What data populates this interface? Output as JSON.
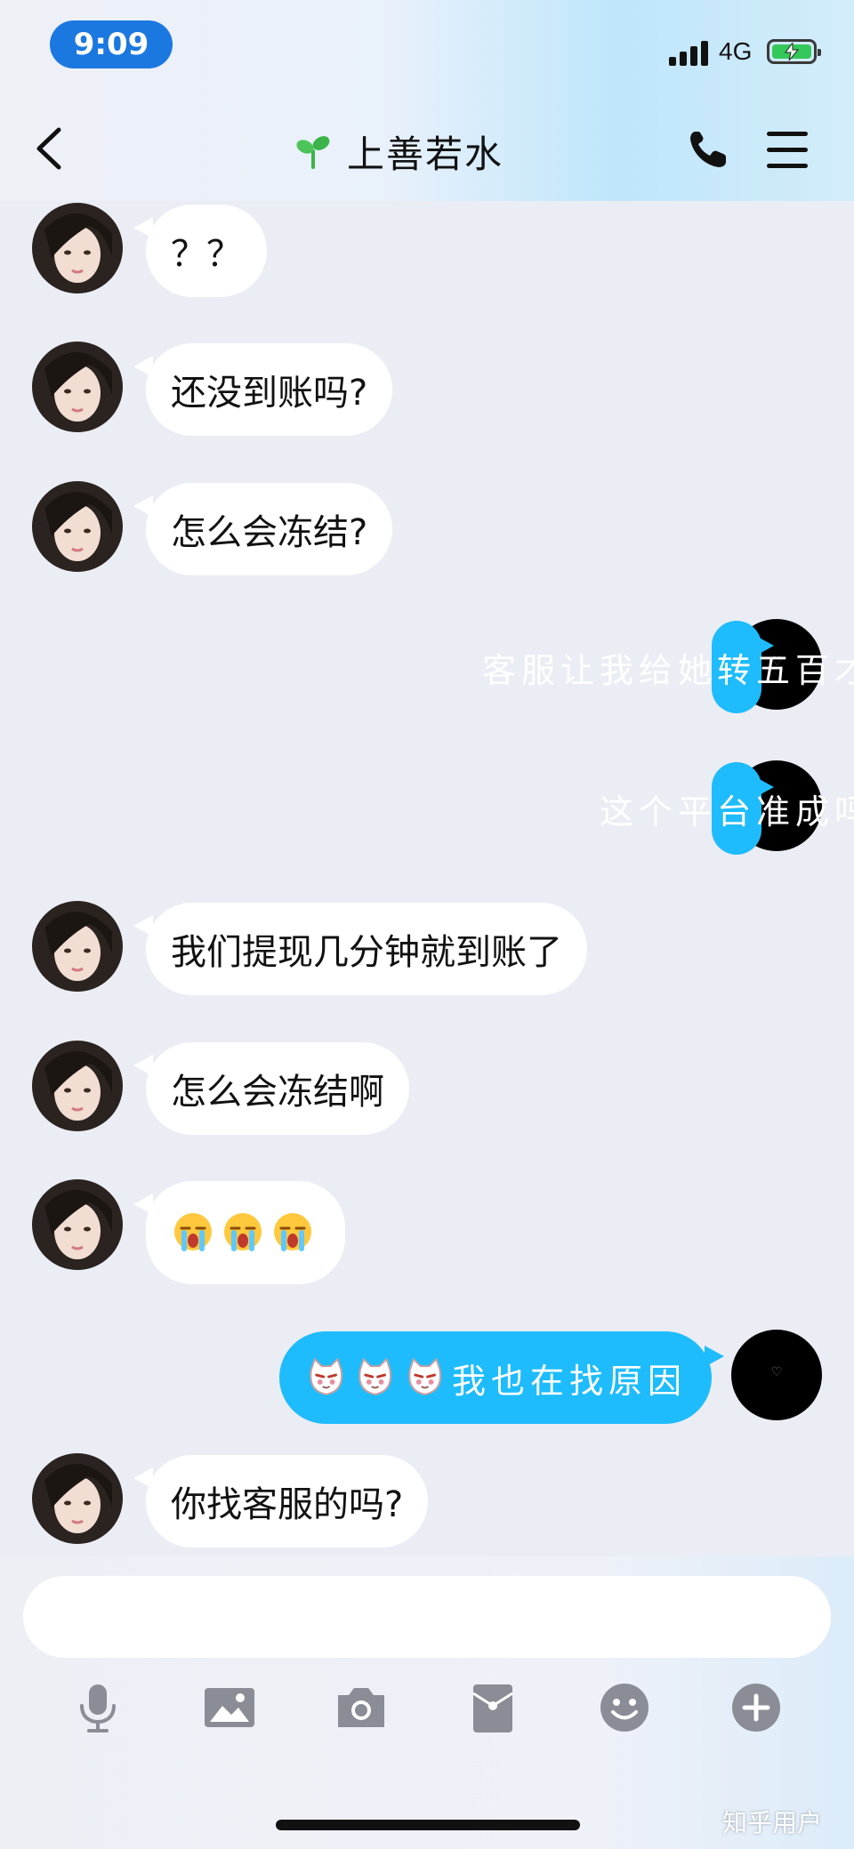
{
  "status_bar": {
    "time": "9:09",
    "network": "4G"
  },
  "header": {
    "title": "上善若水"
  },
  "messages": [
    {
      "side": "in",
      "text": "？？"
    },
    {
      "side": "in",
      "text": "还没到账吗?"
    },
    {
      "side": "in",
      "text": "怎么会冻结?"
    },
    {
      "side": "out",
      "text": "客服让我给她转五百才能解冻"
    },
    {
      "side": "out",
      "text": "这个平台准成吗"
    },
    {
      "side": "in",
      "text": "我们提现几分钟就到账了"
    },
    {
      "side": "in",
      "text": "怎么会冻结啊"
    },
    {
      "side": "in",
      "text": "",
      "emojis": [
        "crying-emoji",
        "crying-emoji",
        "crying-emoji"
      ]
    },
    {
      "side": "out",
      "text": "我也在找原因",
      "emojis": [
        "cat-face-emoji",
        "cat-face-emoji",
        "cat-face-emoji"
      ]
    },
    {
      "side": "in",
      "text": "你找客服的吗?"
    }
  ],
  "input": {
    "value": "",
    "placeholder": ""
  },
  "toolbar": [
    "microphone-icon",
    "image-icon",
    "camera-icon",
    "red-packet-icon",
    "emoji-icon",
    "plus-icon"
  ],
  "watermark": "知乎用户",
  "colors": {
    "outgoing_bubble": "#1ebcfc",
    "incoming_bubble": "#ffffff",
    "background": "#ebedf4",
    "time_pill": "#1b78e0"
  }
}
